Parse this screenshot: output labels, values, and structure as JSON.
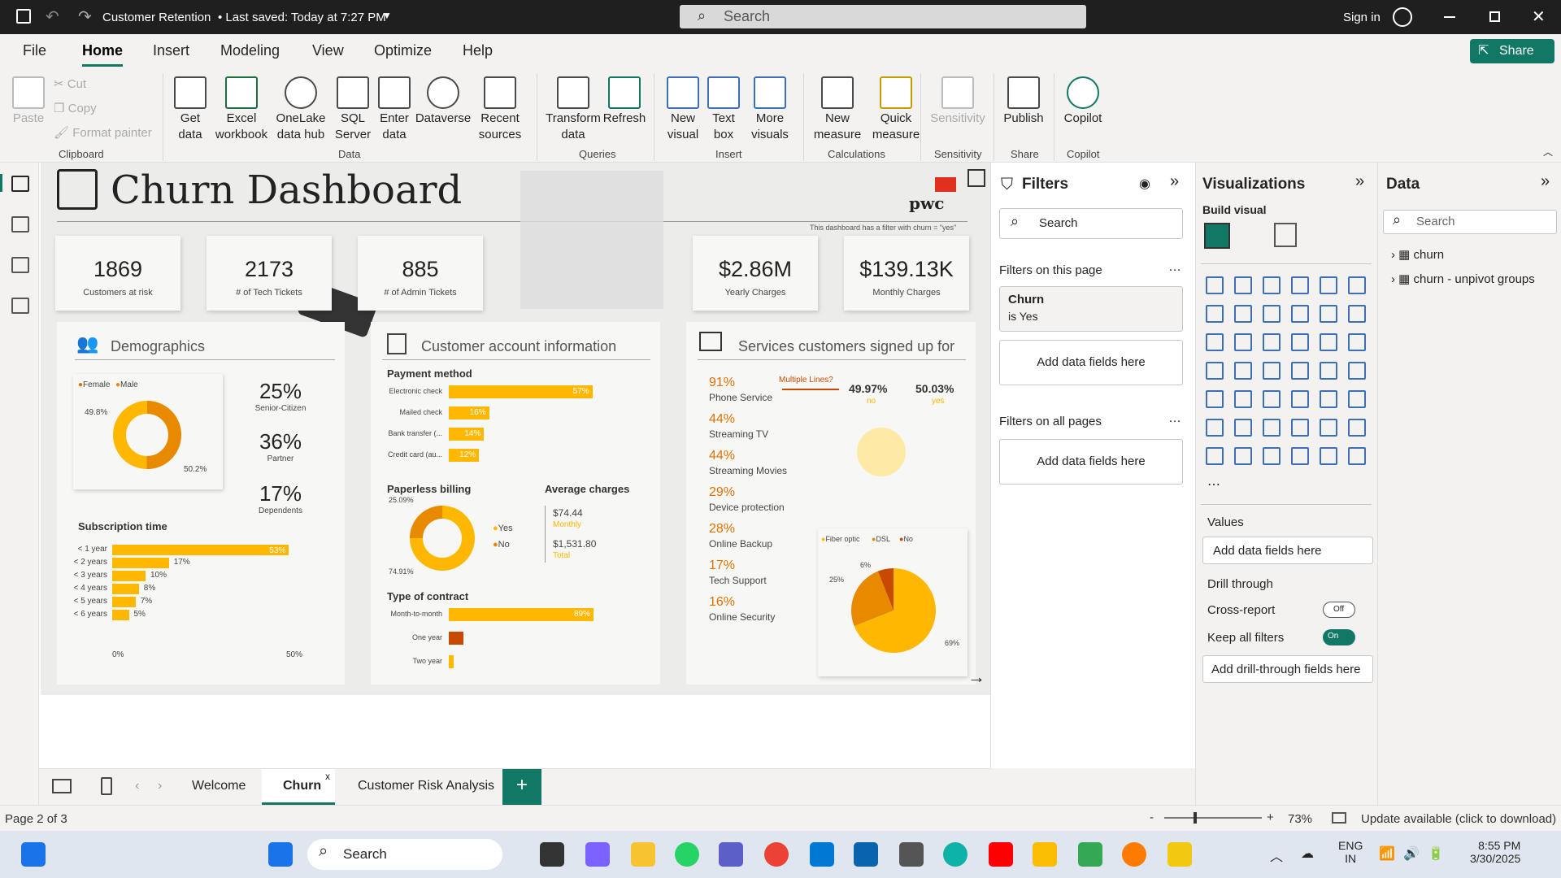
{
  "titlebar": {
    "title": "Customer Retention",
    "saved": "• Last saved: Today at 7:27 PM",
    "search": "Search",
    "signin": "Sign in"
  },
  "menu": [
    "File",
    "Home",
    "Insert",
    "Modeling",
    "View",
    "Optimize",
    "Help"
  ],
  "share": "Share",
  "clipboard": {
    "paste": "Paste",
    "cut": "Cut",
    "copy": "Copy",
    "format_painter": "Format painter",
    "group": "Clipboard"
  },
  "data_group": {
    "items": [
      "Get data",
      "Excel workbook",
      "OneLake data hub",
      "SQL Server",
      "Enter data",
      "Dataverse",
      "Recent sources"
    ],
    "group": "Data"
  },
  "queries": {
    "items": [
      "Transform data",
      "Refresh"
    ],
    "group": "Queries"
  },
  "insert": {
    "items": [
      "New visual",
      "Text box",
      "More visuals"
    ],
    "group": "Insert"
  },
  "calc": {
    "items": [
      "New measure",
      "Quick measure"
    ],
    "group": "Calculations"
  },
  "sens": {
    "items": [
      "Sensitivity"
    ],
    "group": "Sensitivity"
  },
  "sharegrp": {
    "items": [
      "Publish"
    ],
    "group": "Share"
  },
  "copilot": {
    "items": [
      "Copilot"
    ],
    "group": "Copilot"
  },
  "report": {
    "title": "Churn Dashboard",
    "brand": "pwc",
    "note": "This dashboard has a filter with churn = \"yes\"",
    "kpis": [
      {
        "v": "1869",
        "l": "Customers at risk"
      },
      {
        "v": "2173",
        "l": "# of Tech Tickets"
      },
      {
        "v": "885",
        "l": "# of Admin Tickets"
      },
      {
        "v": "$2.86M",
        "l": "Yearly Charges"
      },
      {
        "v": "$139.13K",
        "l": "Monthly Charges"
      }
    ],
    "demographics": {
      "title": "Demographics",
      "legend": [
        "Female",
        "Male"
      ],
      "female": "49.8%",
      "male": "50.2%",
      "stats": [
        {
          "v": "25%",
          "l": "Senior-Citizen"
        },
        {
          "v": "36%",
          "l": "Partner"
        },
        {
          "v": "17%",
          "l": "Dependents"
        }
      ]
    },
    "subscription": {
      "title": "Subscription time",
      "rows": [
        {
          "l": "< 1 year",
          "v": 53
        },
        {
          "l": "< 2 years",
          "v": 17
        },
        {
          "l": "< 3 years",
          "v": 10
        },
        {
          "l": "< 4 years",
          "v": 8
        },
        {
          "l": "< 5 years",
          "v": 7
        },
        {
          "l": "< 6 years",
          "v": 5
        }
      ],
      "axis_min": "0%",
      "axis_max": "50%"
    },
    "account": {
      "title": "Customer account information",
      "payment_title": "Payment method",
      "payment": [
        {
          "l": "Electronic check",
          "v": 57
        },
        {
          "l": "Mailed check",
          "v": 16
        },
        {
          "l": "Bank transfer (...",
          "v": 14
        },
        {
          "l": "Credit card (au...",
          "v": 12
        }
      ],
      "paperless_title": "Paperless billing",
      "paperless": {
        "yes": "74.91%",
        "no": "25.09%",
        "legend": [
          "Yes",
          "No"
        ]
      },
      "avg_title": "Average charges",
      "avg_monthly": "$74.44",
      "avg_monthly_l": "Monthly",
      "avg_total": "$1,531.80",
      "avg_total_l": "Total",
      "contract_title": "Type of contract",
      "contract": [
        {
          "l": "Month-to-month",
          "v": 89
        },
        {
          "l": "One year",
          "v": 9
        },
        {
          "l": "Two year",
          "v": 2
        }
      ]
    },
    "services": {
      "title": "Services customers signed up for",
      "list": [
        {
          "v": "91%",
          "l": "Phone Service"
        },
        {
          "v": "44%",
          "l": "Streaming TV"
        },
        {
          "v": "44%",
          "l": "Streaming Movies"
        },
        {
          "v": "29%",
          "l": "Device protection"
        },
        {
          "v": "28%",
          "l": "Online Backup"
        },
        {
          "v": "17%",
          "l": "Tech Support"
        },
        {
          "v": "16%",
          "l": "Online Security"
        }
      ],
      "multiple": "Multiple Lines?",
      "no_pct": "49.97%",
      "no": "no",
      "yes_pct": "50.03%",
      "yes": "yes",
      "internet_legend": [
        "Fiber optic",
        "DSL",
        "No"
      ],
      "internet": {
        "fiber": "69%",
        "dsl": "25%",
        "none": "6%"
      }
    }
  },
  "filters": {
    "title": "Filters",
    "search": "Search",
    "on_page": "Filters on this page",
    "churn": "Churn",
    "churn_val": "is Yes",
    "add": "Add data fields here",
    "all_pages": "Filters on all pages"
  },
  "viz": {
    "title": "Visualizations",
    "build": "Build visual",
    "values": "Values",
    "add": "Add data fields here",
    "drill": "Drill through",
    "cross": "Cross-report",
    "cross_state": "Off",
    "keep": "Keep all filters",
    "keep_state": "On",
    "add_drill": "Add drill-through fields here"
  },
  "data": {
    "title": "Data",
    "search": "Search",
    "tables": [
      "churn",
      "churn - unpivot groups"
    ]
  },
  "tabs": [
    "Welcome",
    "Churn",
    "Customer Risk Analysis"
  ],
  "status": {
    "page": "Page 2 of 3",
    "zoom": "73%",
    "update": "Update available (click to download)"
  },
  "taskbar": {
    "search": "Search",
    "lang": "ENG",
    "region": "IN",
    "time": "8:55 PM",
    "date": "3/30/2025"
  },
  "chart_data": [
    {
      "type": "pie",
      "title": "Demographics",
      "categories": [
        "Female",
        "Male"
      ],
      "values": [
        49.8,
        50.2
      ]
    },
    {
      "type": "bar",
      "title": "Subscription time",
      "categories": [
        "< 1 year",
        "< 2 years",
        "< 3 years",
        "< 4 years",
        "< 5 years",
        "< 6 years"
      ],
      "values": [
        53,
        17,
        10,
        8,
        7,
        5
      ]
    },
    {
      "type": "bar",
      "title": "Payment method",
      "categories": [
        "Electronic check",
        "Mailed check",
        "Bank transfer (...",
        "Credit card (au..."
      ],
      "values": [
        57,
        16,
        14,
        12
      ]
    },
    {
      "type": "pie",
      "title": "Paperless billing",
      "categories": [
        "Yes",
        "No"
      ],
      "values": [
        74.91,
        25.09
      ]
    },
    {
      "type": "bar",
      "title": "Type of contract",
      "categories": [
        "Month-to-month",
        "One year",
        "Two year"
      ],
      "values": [
        89,
        9,
        2
      ]
    },
    {
      "type": "pie",
      "categories": [
        "Fiber optic",
        "DSL",
        "No"
      ],
      "values": [
        69,
        25,
        6
      ]
    }
  ]
}
